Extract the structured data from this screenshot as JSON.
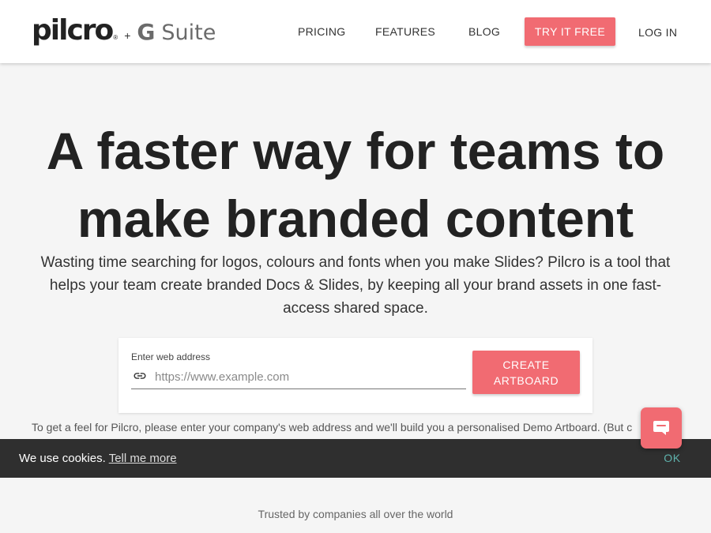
{
  "header": {
    "logo": {
      "brand": "pilcro",
      "reg_mark": "®",
      "plus": "+",
      "g_letter": "G",
      "suite": "Suite"
    },
    "nav": {
      "pricing": "PRICING",
      "features": "FEATURES",
      "blog": "BLOG",
      "try_free": "TRY IT FREE",
      "log_in": "LOG IN"
    }
  },
  "hero": {
    "title": "A faster way for teams to make branded content",
    "subtitle": "Wasting time searching for logos, colours and fonts when you make Slides? Pilcro is a tool that helps your team create branded Docs & Slides, by keeping all your brand assets in one fast-access shared space."
  },
  "artboard_form": {
    "label": "Enter web address",
    "value": "",
    "placeholder": "https://www.example.com",
    "button_line1": "CREATE",
    "button_line2": "ARTBOARD",
    "icon": "link-icon"
  },
  "demo_note": "To get a feel for Pilcro, please enter your company's web address and we'll build you a personalised Demo Artboard. (But c",
  "cookie_bar": {
    "text": "We use cookies.",
    "link": "Tell me more",
    "ok": "OK"
  },
  "chat": {
    "icon": "chat-bubble-icon"
  },
  "trusted": "Trusted by companies all over the world",
  "colors": {
    "accent": "#f16b72",
    "cookie_bg": "#2f2f2f",
    "ok_text": "#5fb3ad",
    "page_bg": "#f5f5f5"
  }
}
